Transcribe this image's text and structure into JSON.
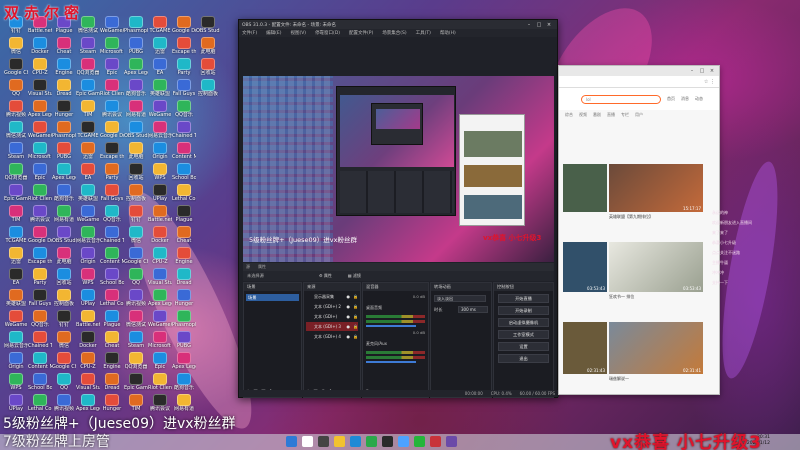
{
  "desktop": {
    "watermark_top": "双赤尔密",
    "icon_labels": [
      "钉钉",
      "微信",
      "Google Chrome",
      "QQ",
      "腾讯视频",
      "微信测试",
      "Steam",
      "QQ浏览器",
      "Epic Games",
      "TIM",
      "TCGAME",
      "迅雷",
      "EA",
      "英雄联盟",
      "WeGame",
      "网易云音乐",
      "Origin",
      "WPS",
      "UPlay",
      "Battle.net",
      "Docker",
      "CPU-Z",
      "Visual Studio",
      "Apex Legends",
      "WeGame版",
      "Microsoft Edge",
      "Epic",
      "Riot Client",
      "腾讯会议",
      "Google Drive",
      "Escape the Backrooms",
      "Party",
      "Fall Guys",
      "QQ音乐",
      "Chained Together",
      "Content Manager",
      "School Boy",
      "Lethal Company",
      "Plague",
      "Cheat",
      "Engine",
      "Dread",
      "Hunger",
      "Phasmophobia",
      "PUBG",
      "Apex Legends",
      "酷狗音乐",
      "网易有道",
      "OBS Studio",
      "此电脑",
      "回收站",
      "控制面板"
    ]
  },
  "obs": {
    "title": "OBS 31.0.3 - 配置文件: 未命名 - 场景: 未命名",
    "menu": [
      "文件(F)",
      "编辑(E)",
      "视图(V)",
      "停靠窗口(D)",
      "配置文件(P)",
      "场景集合(S)",
      "工具(T)",
      "帮助(H)"
    ],
    "context_bar": {
      "left": "源",
      "left2": "属性",
      "filters": "滤镜",
      "tools": [
        "属性",
        "滤镜"
      ]
    },
    "top_dock": {
      "label": "未选择源",
      "btn1": "⚙ 属性",
      "btn2": "▦ 滤镜"
    },
    "scenes": {
      "title": "场景",
      "items": [
        "场景"
      ]
    },
    "sources": {
      "title": "来源",
      "items": [
        "显示器采集",
        "文本 (GDI+) 2",
        "文本 (GDI+)",
        "文本 (GDI+) 3",
        "文本 (GDI+) 4"
      ]
    },
    "mixer": {
      "title": "混音器",
      "channels": [
        {
          "name": "桌面音频",
          "db": "0.0 dB"
        },
        {
          "name": "麦克风/Aux",
          "db": "0.0 dB"
        }
      ]
    },
    "transitions": {
      "title": "转场动画",
      "type": "淡入淡出",
      "duration_label": "时长",
      "duration": "300 ms"
    },
    "controls": {
      "title": "控制按钮",
      "buttons": [
        "开始直播",
        "开始录制",
        "启动虚拟摄像机",
        "工作室模式",
        "设置",
        "退出"
      ]
    },
    "status": {
      "cpu": "CPU: 0.4%",
      "fps": "60.00 / 60.00 FPS",
      "time": "00:00:00"
    },
    "preview_watermark_1": "5级粉丝牌+（Juese09）进vx粉丝群",
    "preview_watermark_2": "vx恭喜 小七升级3"
  },
  "browser": {
    "search_placeholder": "lol",
    "nav_icons": [
      "首页",
      "消息",
      "动态",
      "收藏",
      "历史"
    ],
    "tabs": [
      "综合",
      "视频",
      "番剧",
      "直播",
      "专栏",
      "用户"
    ],
    "cards": [
      {
        "dur": "15:17:17",
        "title": "英雄联盟【第九期排位】"
      },
      {
        "dur": "13:12:03",
        "title": "英雄联盟 精彩集锦"
      },
      {
        "dur": "03:53:43",
        "title": "狂欢节一 排位"
      },
      {
        "dur": "03:53:43",
        "title": "高端局对线"
      },
      {
        "dur": "02:31:43",
        "title": "瑞兹解说一"
      },
      {
        "dur": "02:31:41",
        "title": "英雄联盟 集锦"
      }
    ]
  },
  "side_chat": {
    "lines": [
      "永远的神",
      "欢迎新朋友进入直播间",
      "来了来了",
      "恭喜小七升级",
      "点点关注不迷路",
      "主播牛逼",
      "冲冲冲",
      "支持一下"
    ]
  },
  "overlays": {
    "bottom_line_1": "5级粉丝牌+（Juese09）进vx粉丝群",
    "bottom_line_2": "7级粉丝牌上房管",
    "bottom_right": "vx恭喜 小七升级3"
  },
  "taskbar": {
    "time": "20:31",
    "date": "2025/1/12"
  },
  "colors": {
    "watermark_red": "#e0142c",
    "obs_bg": "#1f2128",
    "scene_selected": "#2d5e9f",
    "source_selected": "#7a2026"
  }
}
